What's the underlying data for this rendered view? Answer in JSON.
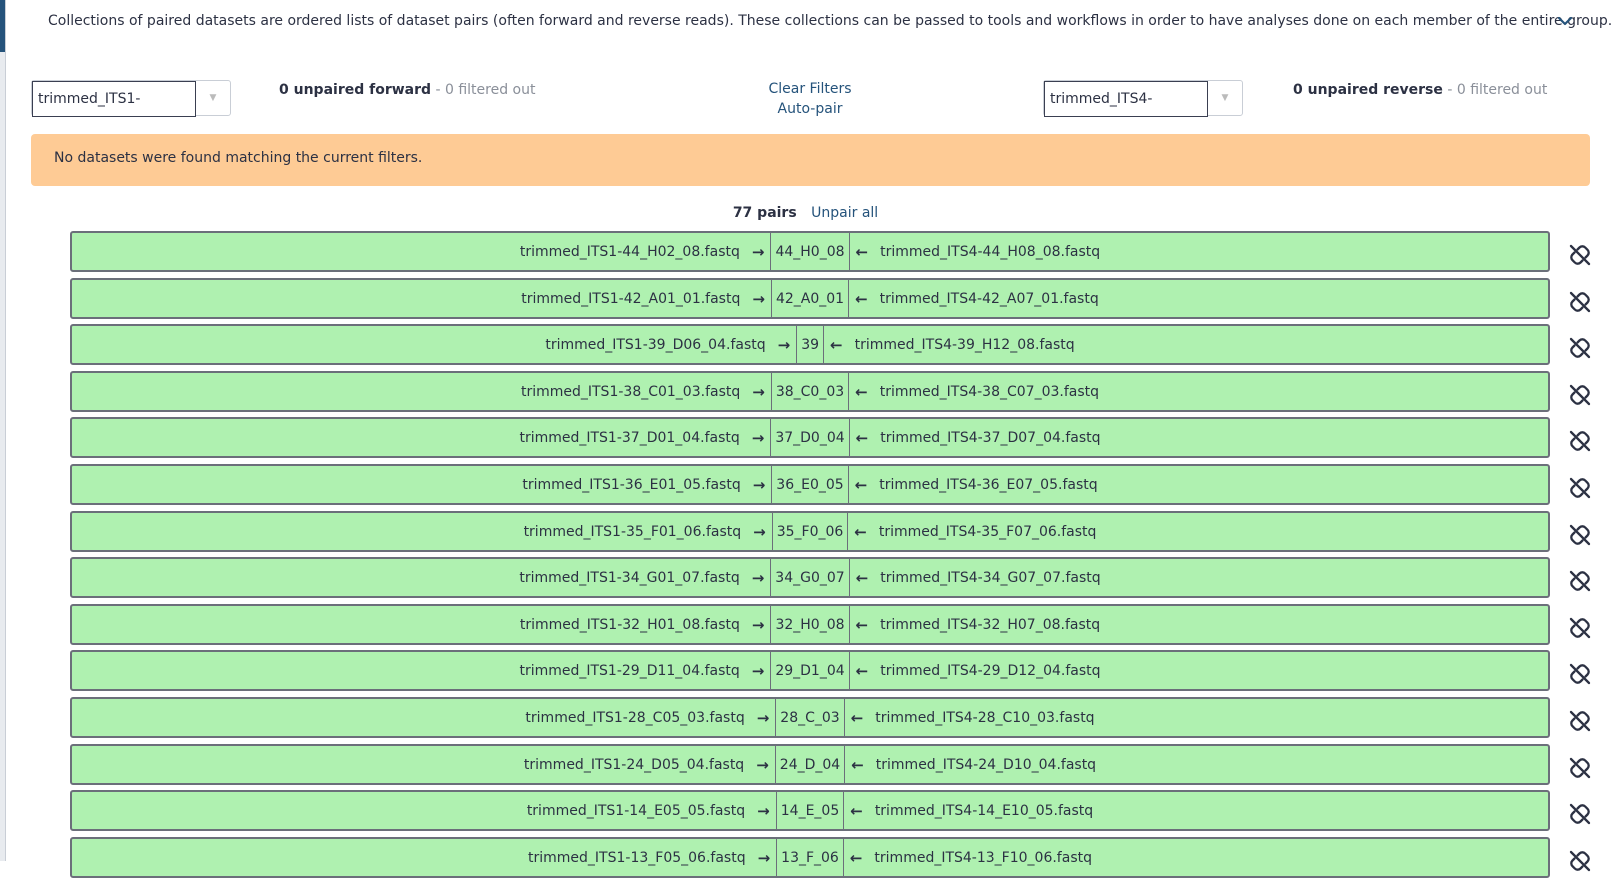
{
  "intro": {
    "text": "Collections of paired datasets are ordered lists of dataset pairs (often forward and reverse reads). These collections can be passed to tools and workflows in order to have analyses done on each member of the entire group. ..."
  },
  "forward": {
    "filter_value": "trimmed_ITS1-",
    "unpaired_count": "0 unpaired forward",
    "filtered_out": "- 0 filtered out"
  },
  "reverse": {
    "filter_value": "trimmed_ITS4-",
    "unpaired_count": "0 unpaired reverse",
    "filtered_out": "- 0 filtered out"
  },
  "actions": {
    "clear_filters": "Clear Filters",
    "auto_pair": "Auto-pair"
  },
  "warning": "No datasets were found matching the current filters.",
  "pairs_header": {
    "count": "77 pairs",
    "unpair_all": "Unpair all"
  },
  "pairs": [
    {
      "forward": "trimmed_ITS1-44_H02_08.fastq",
      "name": "44_H0_08",
      "reverse": "trimmed_ITS4-44_H08_08.fastq"
    },
    {
      "forward": "trimmed_ITS1-42_A01_01.fastq",
      "name": "42_A0_01",
      "reverse": "trimmed_ITS4-42_A07_01.fastq"
    },
    {
      "forward": "trimmed_ITS1-39_D06_04.fastq",
      "name": "39",
      "reverse": "trimmed_ITS4-39_H12_08.fastq"
    },
    {
      "forward": "trimmed_ITS1-38_C01_03.fastq",
      "name": "38_C0_03",
      "reverse": "trimmed_ITS4-38_C07_03.fastq"
    },
    {
      "forward": "trimmed_ITS1-37_D01_04.fastq",
      "name": "37_D0_04",
      "reverse": "trimmed_ITS4-37_D07_04.fastq"
    },
    {
      "forward": "trimmed_ITS1-36_E01_05.fastq",
      "name": "36_E0_05",
      "reverse": "trimmed_ITS4-36_E07_05.fastq"
    },
    {
      "forward": "trimmed_ITS1-35_F01_06.fastq",
      "name": "35_F0_06",
      "reverse": "trimmed_ITS4-35_F07_06.fastq"
    },
    {
      "forward": "trimmed_ITS1-34_G01_07.fastq",
      "name": "34_G0_07",
      "reverse": "trimmed_ITS4-34_G07_07.fastq"
    },
    {
      "forward": "trimmed_ITS1-32_H01_08.fastq",
      "name": "32_H0_08",
      "reverse": "trimmed_ITS4-32_H07_08.fastq"
    },
    {
      "forward": "trimmed_ITS1-29_D11_04.fastq",
      "name": "29_D1_04",
      "reverse": "trimmed_ITS4-29_D12_04.fastq"
    },
    {
      "forward": "trimmed_ITS1-28_C05_03.fastq",
      "name": "28_C_03",
      "reverse": "trimmed_ITS4-28_C10_03.fastq"
    },
    {
      "forward": "trimmed_ITS1-24_D05_04.fastq",
      "name": "24_D_04",
      "reverse": "trimmed_ITS4-24_D10_04.fastq"
    },
    {
      "forward": "trimmed_ITS1-14_E05_05.fastq",
      "name": "14_E_05",
      "reverse": "trimmed_ITS4-14_E10_05.fastq"
    },
    {
      "forward": "trimmed_ITS1-13_F05_06.fastq",
      "name": "13_F_06",
      "reverse": "trimmed_ITS4-13_F10_06.fastq"
    }
  ]
}
